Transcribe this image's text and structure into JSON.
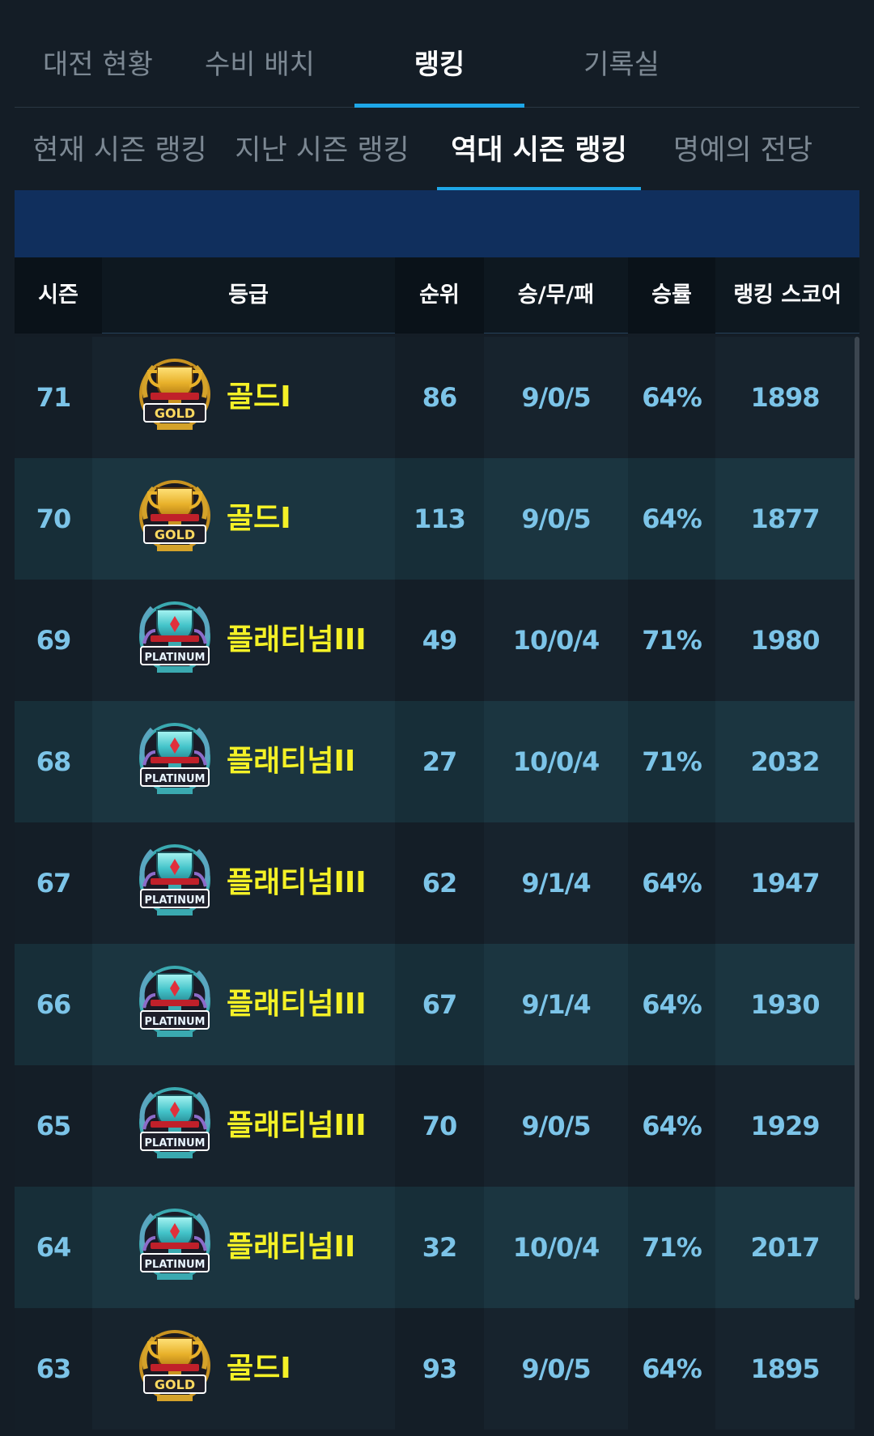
{
  "top_tabs": [
    {
      "label": "대전 현황",
      "active": false
    },
    {
      "label": "수비 배치",
      "active": false
    },
    {
      "label": "랭킹",
      "active": true
    },
    {
      "label": "기록실",
      "active": false
    }
  ],
  "sub_tabs": [
    {
      "label": "현재 시즌 랭킹",
      "active": false
    },
    {
      "label": "지난 시즌 랭킹",
      "active": false
    },
    {
      "label": "역대 시즌 랭킹",
      "active": true
    },
    {
      "label": "명예의 전당",
      "active": false
    }
  ],
  "table": {
    "headers": [
      "시즌",
      "등급",
      "순위",
      "승/무/패",
      "승률",
      "랭킹 스코어"
    ],
    "rows": [
      {
        "season": "71",
        "grade": "골드I",
        "badge": "gold-trophy-badge",
        "badge_text": "GOLD",
        "rank": "86",
        "record": "9/0/5",
        "win_rate": "64%",
        "score": "1898"
      },
      {
        "season": "70",
        "grade": "골드I",
        "badge": "gold-trophy-badge",
        "badge_text": "GOLD",
        "rank": "113",
        "record": "9/0/5",
        "win_rate": "64%",
        "score": "1877"
      },
      {
        "season": "69",
        "grade": "플래티넘III",
        "badge": "platinum-trophy-badge",
        "badge_text": "PLATINUM",
        "rank": "49",
        "record": "10/0/4",
        "win_rate": "71%",
        "score": "1980"
      },
      {
        "season": "68",
        "grade": "플래티넘II",
        "badge": "platinum-trophy-badge",
        "badge_text": "PLATINUM",
        "rank": "27",
        "record": "10/0/4",
        "win_rate": "71%",
        "score": "2032"
      },
      {
        "season": "67",
        "grade": "플래티넘III",
        "badge": "platinum-trophy-badge",
        "badge_text": "PLATINUM",
        "rank": "62",
        "record": "9/1/4",
        "win_rate": "64%",
        "score": "1947"
      },
      {
        "season": "66",
        "grade": "플래티넘III",
        "badge": "platinum-trophy-badge",
        "badge_text": "PLATINUM",
        "rank": "67",
        "record": "9/1/4",
        "win_rate": "64%",
        "score": "1930"
      },
      {
        "season": "65",
        "grade": "플래티넘III",
        "badge": "platinum-trophy-badge",
        "badge_text": "PLATINUM",
        "rank": "70",
        "record": "9/0/5",
        "win_rate": "64%",
        "score": "1929"
      },
      {
        "season": "64",
        "grade": "플래티넘II",
        "badge": "platinum-trophy-badge",
        "badge_text": "PLATINUM",
        "rank": "32",
        "record": "10/0/4",
        "win_rate": "71%",
        "score": "2017"
      },
      {
        "season": "63",
        "grade": "골드I",
        "badge": "gold-trophy-badge",
        "badge_text": "GOLD",
        "rank": "93",
        "record": "9/0/5",
        "win_rate": "64%",
        "score": "1895"
      }
    ]
  },
  "colors": {
    "background": "#141d26",
    "accent": "#1ea7e8",
    "banner": "#102f5d",
    "grade_text": "#f4f127",
    "value_text": "#7cc4e8",
    "gold": "#e8b12a",
    "platinum": "#43c3c9"
  }
}
